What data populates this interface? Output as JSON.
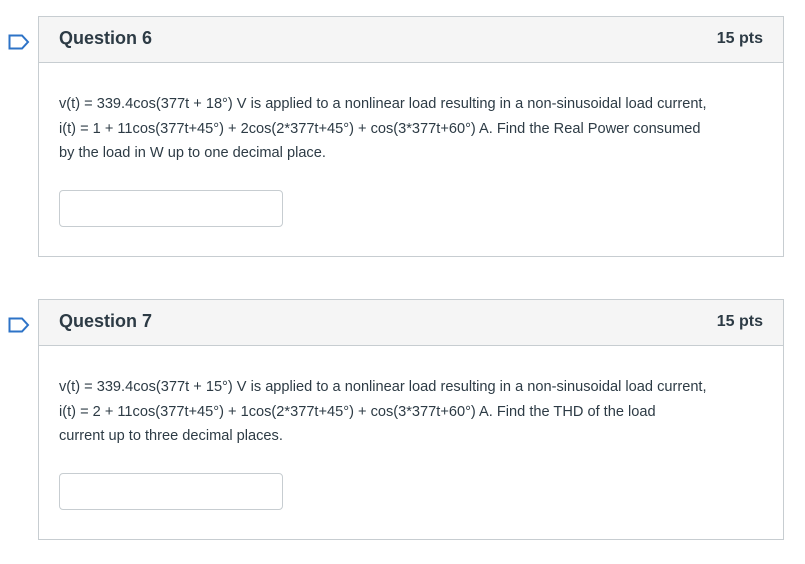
{
  "questions": [
    {
      "title": "Question 6",
      "points": "15 pts",
      "text": "v(t) = 339.4cos(377t + 18°) V is applied to a nonlinear load resulting in a non-sinusoidal load current,\ni(t) = 1 + 11cos(377t+45°) + 2cos(2*377t+45°) + cos(3*377t+60°) A. Find the Real Power consumed\nby the load in W up to one decimal place.",
      "answer_value": ""
    },
    {
      "title": "Question 7",
      "points": "15 pts",
      "text": "v(t) = 339.4cos(377t + 15°) V is applied to a nonlinear load resulting in a non-sinusoidal load current,\ni(t) = 2 + 11cos(377t+45°) + 1cos(2*377t+45°) + cos(3*377t+60°) A. Find the THD of the load\ncurrent up to three decimal places.",
      "answer_value": ""
    }
  ],
  "colors": {
    "flag": "#2d73c7",
    "header_bg": "#f5f5f5",
    "border": "#c7cdd1",
    "text": "#2d3b45"
  },
  "icons": {
    "flag": "bookmark-flag-icon"
  }
}
